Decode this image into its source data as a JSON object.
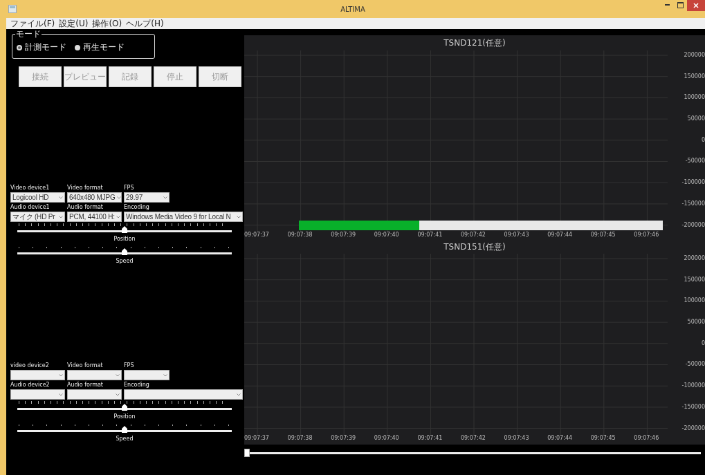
{
  "window": {
    "title": "ALTIMA"
  },
  "menu": [
    "ファイル(F)",
    "設定(U)",
    "操作(O)",
    "ヘルプ(H)"
  ],
  "mode": {
    "label": "モード",
    "options": [
      {
        "label": "計測モード",
        "selected": true
      },
      {
        "label": "再生モード",
        "selected": false
      }
    ]
  },
  "buttons": [
    "接続",
    "プレビュー",
    "記録",
    "停止",
    "切断"
  ],
  "devices": [
    {
      "fields": [
        {
          "label": "Video device1",
          "value": "Logicool HD"
        },
        {
          "label": "Video format",
          "value": "640x480 MJPG"
        },
        {
          "label": "FPS",
          "value": "29.97"
        },
        {
          "label": "Audio device1",
          "value": "マイク (HD Pr"
        },
        {
          "label": "Audio format",
          "value": "PCM, 44100 H:"
        },
        {
          "label": "Encoding",
          "value": "Windows Media Video 9 for Local N"
        }
      ],
      "sliders": [
        {
          "label": "Position",
          "level": 0.5
        },
        {
          "label": "Speed",
          "level": 0.5
        }
      ]
    },
    {
      "fields": [
        {
          "label": "video device2"
        },
        {
          "label": "Video format"
        },
        {
          "label": "FPS"
        },
        {
          "label": "Audio device2"
        },
        {
          "label": "Audio format"
        },
        {
          "label": "Encoding"
        }
      ],
      "sliders": [
        {
          "label": "Position",
          "level": 0.5
        },
        {
          "label": "Speed",
          "level": 0.5
        }
      ]
    }
  ],
  "charts": [
    {
      "title": "TSND121(任意)",
      "y_labels": [
        "200000",
        "150000",
        "100000",
        "50000",
        "0",
        "-50000",
        "-100000",
        "-150000",
        "-200000"
      ],
      "x_labels": [
        "09:07:37",
        "09:07:38",
        "09:07:39",
        "09:07:40",
        "09:07:41",
        "09:07:42",
        "09:07:43",
        "09:07:44",
        "09:07:45",
        "09:07:46"
      ],
      "progress": {
        "level": 0.33
      }
    },
    {
      "title": "TSND151(任意)",
      "y_labels": [
        "200000",
        "150000",
        "100000",
        "50000",
        "0",
        "-50000",
        "-100000",
        "-150000",
        "-200000"
      ],
      "x_labels": [
        "09:07:37",
        "09:07:38",
        "09:07:39",
        "09:07:40",
        "09:07:41",
        "09:07:42",
        "09:07:43",
        "09:07:44",
        "09:07:45",
        "09:07:46"
      ]
    }
  ],
  "timeline": {
    "level": 0
  }
}
